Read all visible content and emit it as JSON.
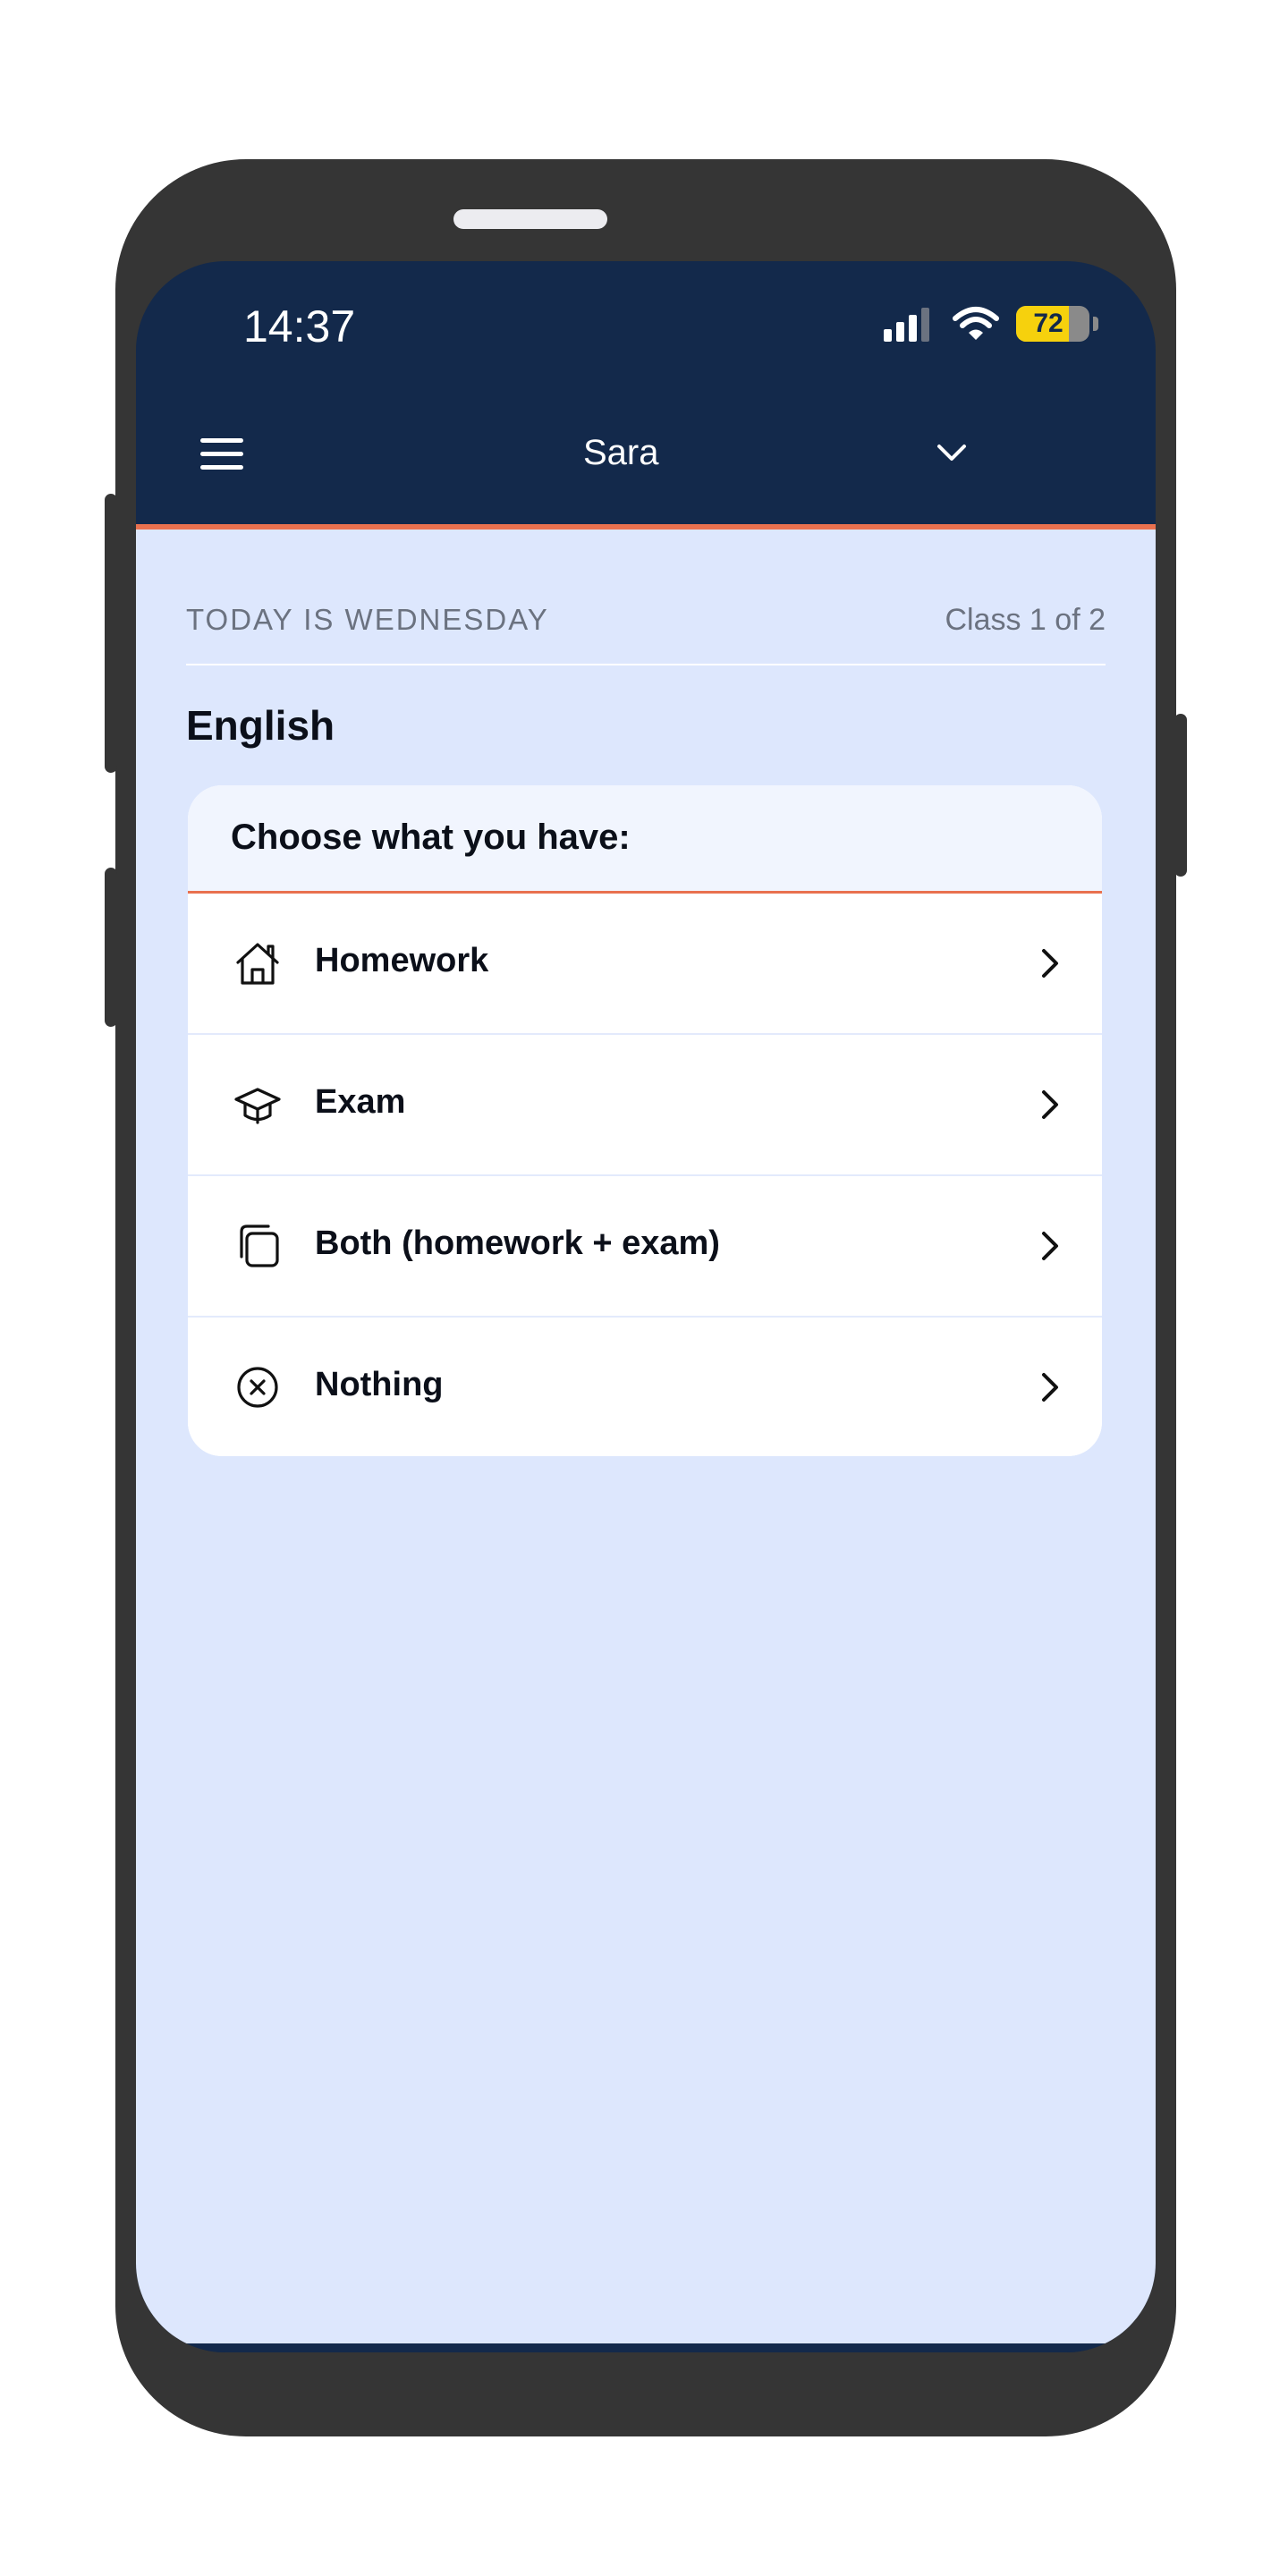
{
  "status_bar": {
    "time": "14:37",
    "battery_level": "72",
    "battery_fill_percent": 72,
    "icons": [
      "cellular-signal-icon",
      "wifi-icon",
      "battery-icon"
    ]
  },
  "app_bar": {
    "menu_icon": "hamburger-menu-icon",
    "user_name": "Sara",
    "dropdown_icon": "chevron-down-icon"
  },
  "day_header": {
    "day_label": "TODAY IS WEDNESDAY",
    "class_count": "Class 1 of 2"
  },
  "subject": "English",
  "card": {
    "title": "Choose what you have:",
    "options": [
      {
        "label": "Homework",
        "icon": "house-icon"
      },
      {
        "label": "Exam",
        "icon": "graduation-cap-icon"
      },
      {
        "label": "Both (homework + exam)",
        "icon": "copy-icon"
      },
      {
        "label": "Nothing",
        "icon": "x-circle-icon"
      }
    ]
  },
  "colors": {
    "navy": "#13294b",
    "accent": "#e9714f",
    "background": "#dde7fd",
    "card_header": "#f1f5fe",
    "battery": "#f6d10d"
  }
}
